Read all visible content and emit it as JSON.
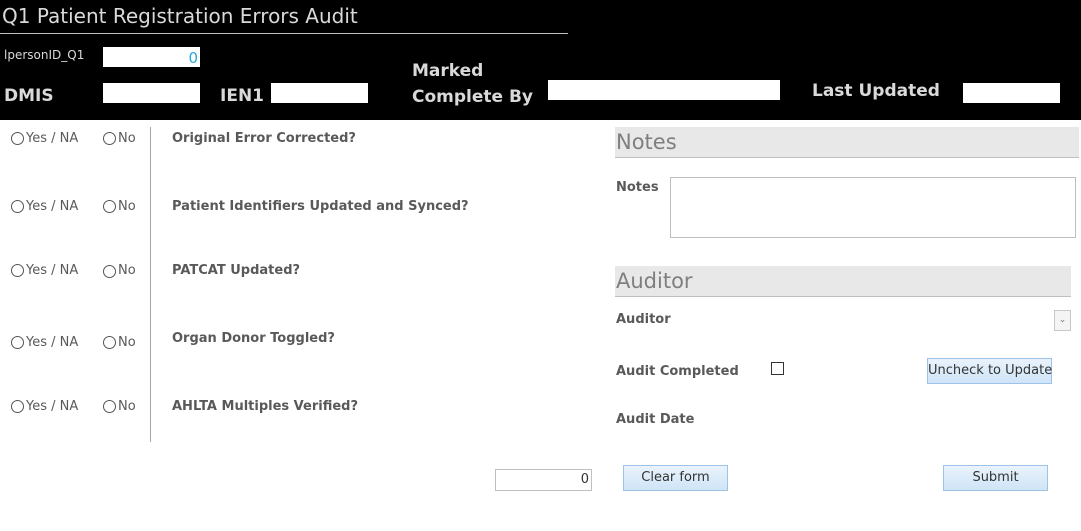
{
  "form": {
    "title": "Q1 Patient Registration Errors Audit"
  },
  "header": {
    "lperson_label": "lpersonID_Q1",
    "lperson_value": "0",
    "dmis_label": "DMIS",
    "dmis_value": "",
    "ien1_label": "IEN1",
    "ien1_value": "",
    "marked_label_line1": "Marked",
    "marked_label_line2": "Complete By",
    "marked_value": "",
    "last_updated_label": "Last Updated",
    "last_updated_value": ""
  },
  "options": {
    "yes_label": "Yes / NA",
    "no_label": "No"
  },
  "questions": [
    "Original Error Corrected?",
    "Patient Identifiers Updated and Synced?",
    "PATCAT Updated?",
    "Organ Donor Toggled?",
    "AHLTA Multiples Verified?"
  ],
  "notes_section": {
    "heading": "Notes",
    "field_label": "Notes",
    "value": ""
  },
  "auditor_section": {
    "heading": "Auditor",
    "auditor_label": "Auditor",
    "auditor_value": "",
    "audit_completed_label": "Audit Completed",
    "audit_completed_checked": false,
    "uncheck_button": "Uncheck to Update",
    "audit_date_label": "Audit Date",
    "audit_date_value": ""
  },
  "footer": {
    "counter_value": "0",
    "clear_button": "Clear form",
    "submit_button": "Submit"
  },
  "colors": {
    "header_bg": "#000000",
    "header_text": "#d9d9d9",
    "accent_value": "#2aa7d8",
    "section_bg": "#e8e8e8",
    "button_bg": "#d6e8f8"
  },
  "icons": {
    "dropdown": "chevron-down-icon"
  }
}
